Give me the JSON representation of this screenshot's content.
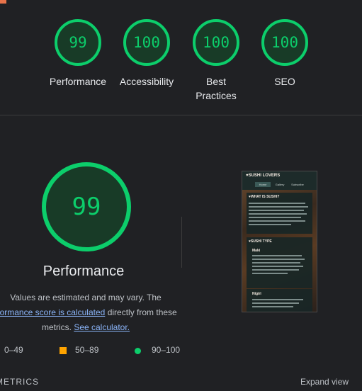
{
  "scores": [
    {
      "value": "99",
      "label": "Performance"
    },
    {
      "value": "100",
      "label": "Accessibility"
    },
    {
      "value": "100",
      "label": "Best Practices"
    },
    {
      "value": "100",
      "label": "SEO"
    }
  ],
  "performance": {
    "score": "99",
    "title": "Performance",
    "note_prefix": "Values are estimated and may vary. The",
    "note_link": "rformance score is calculated",
    "note_middle": "directly from these",
    "note_suffix": "metrics.",
    "calculator_link": "See calculator."
  },
  "legend": {
    "fail": "0–49",
    "average": "50–89",
    "pass": "90–100"
  },
  "footer": {
    "metrics_label": "METRICS",
    "expand_label": "Expand view"
  },
  "thumbnail": {
    "site_title": "♥SUSHI LOVERS",
    "nav": [
      "Home",
      "Gallery",
      "Subscribe"
    ],
    "section1": "♥WHAT IS SUSHI?",
    "section2": "♥SUSHI TYPE",
    "sub1": "Maki",
    "sub2": "Nigiri"
  },
  "colors": {
    "pass": "#0cce6b",
    "average": "#ffa400",
    "fail": "#ff4e42",
    "link": "#8ab4f8",
    "background": "#202124"
  }
}
